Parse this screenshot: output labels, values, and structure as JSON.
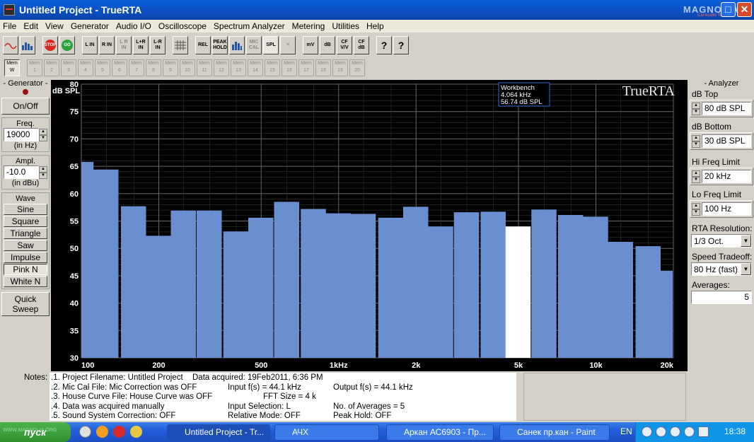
{
  "window": {
    "title": "Untitled Project - TrueRTA",
    "logo_text": "MAGNOLIA",
    "logo_sub": "CarAudio Team"
  },
  "menu": [
    "File",
    "Edit",
    "View",
    "Generator",
    "Audio I/O",
    "Oscilloscope",
    "Spectrum Analyzer",
    "Metering",
    "Utilities",
    "Help"
  ],
  "toolbar": {
    "stop_label": "STOP",
    "go_label": "GO",
    "channel_buttons": [
      "L IN",
      "R IN",
      "L R IN",
      "L+R IN",
      "L-R IN"
    ],
    "view_buttons": [
      "REL",
      "PEAK HOLD",
      "MIC CAL",
      "SPL"
    ],
    "unit_buttons": [
      "mV",
      "dB",
      "CF V/V",
      "CF dB"
    ],
    "help_labels": [
      "?",
      "?"
    ]
  },
  "memory": {
    "active_label": "Mem W",
    "slots": [
      "Mem 1",
      "Mem 2",
      "Mem 3",
      "Mem 4",
      "Mem 5",
      "Mem 6",
      "Mem 7",
      "Mem 8",
      "Mem 9",
      "Mem 10",
      "Mem 11",
      "Mem 12",
      "Mem 13",
      "Mem 14",
      "Mem 15",
      "Mem 16",
      "Mem 17",
      "Mem 18",
      "Mem 19",
      "Mem 20"
    ]
  },
  "generator": {
    "title": "Generator",
    "onoff_label": "On/Off",
    "freq_label": "Freq.",
    "freq_value": "19000",
    "freq_unit": "(in Hz)",
    "ampl_label": "Ampl.",
    "ampl_value": "-10.0",
    "ampl_unit": "(in dBu)",
    "wave_label": "Wave",
    "waves": [
      "Sine",
      "Square",
      "Triangle",
      "Saw",
      "Impulse",
      "Pink N",
      "White N"
    ],
    "quick_sweep_label": [
      "Quick",
      "Sweep"
    ]
  },
  "analyzer": {
    "title": "Analyzer",
    "db_top_label": "dB Top",
    "db_top_value": "80 dB SPL",
    "db_bottom_label": "dB Bottom",
    "db_bottom_value": "30 dB SPL",
    "hi_freq_label": "Hi Freq Limit",
    "hi_freq_value": "20 kHz",
    "lo_freq_label": "Lo Freq Limit",
    "lo_freq_value": "100 Hz",
    "resolution_label": "RTA Resolution:",
    "resolution_value": "1/3 Oct.",
    "speed_label": "Speed Tradeoff:",
    "speed_value": "80 Hz (fast)",
    "averages_label": "Averages:",
    "averages_value": "5"
  },
  "chart_data": {
    "type": "bar",
    "ylabel": "dB SPL",
    "ylim": [
      30,
      80
    ],
    "yticks": [
      30,
      35,
      40,
      45,
      50,
      55,
      60,
      65,
      70,
      75,
      80
    ],
    "xscale": "log",
    "xlim": [
      100,
      20000
    ],
    "xtick_labels": [
      {
        "x": 100,
        "label": "100"
      },
      {
        "x": 200,
        "label": "200"
      },
      {
        "x": 500,
        "label": "500"
      },
      {
        "x": 1000,
        "label": "1kHz"
      },
      {
        "x": 2000,
        "label": "2k"
      },
      {
        "x": 5000,
        "label": "5k"
      },
      {
        "x": 10000,
        "label": "10k"
      },
      {
        "x": 20000,
        "label": "20k"
      }
    ],
    "brand": "TrueRTA",
    "cursor": {
      "title": "Workbench",
      "freq": "4.064 kHz",
      "level": "56.74 dB SPL"
    },
    "highlight_band": 17,
    "bands": [
      100,
      125,
      160,
      200,
      250,
      315,
      400,
      500,
      630,
      800,
      1000,
      1250,
      1600,
      2000,
      2500,
      3150,
      4000,
      5000,
      6300,
      8000,
      10000,
      12500,
      16000,
      20000
    ],
    "values": [
      65.8,
      64.4,
      57.7,
      52.3,
      56.9,
      56.9,
      53.1,
      55.6,
      58.5,
      57.2,
      56.4,
      56.3,
      55.6,
      57.6,
      54.0,
      56.6,
      56.7,
      54.0,
      57.1,
      56.1,
      55.8,
      51.2,
      50.4,
      45.9
    ],
    "bar_color": "#6a8fd0",
    "highlight_color": "#ffffff",
    "grid": true
  },
  "notes": {
    "label": "Notes:",
    "lines": [
      ".1. Project Filename: Untitled Project",
      ".2. Mic Cal File: Mic Correction was OFF",
      ".3. House Curve File: House Curve was OFF",
      ".4. Data was acquired manually",
      ".5. Sound System Correction: OFF"
    ],
    "acquired": "Data acquired: 19Feb2011, 6:36 PM",
    "input_fs": "Input f(s) = 44.1 kHz",
    "fft_size": "FFT Size = 4 k",
    "input_selection": "Input Selection: L",
    "relative_mode": "Relative Mode: OFF",
    "output_fs": "Output f(s) = 44.1 kHz",
    "averages": "No. of Averages = 5",
    "peak_hold": "Peak Hold: OFF"
  },
  "taskbar": {
    "start_label": "пуск",
    "watermark": "WWW.MAGNOLIA.ORG",
    "tasks": [
      "Untitled Project - Tr...",
      "АЧХ",
      "Аркан АС6903 - Пр...",
      "Санек пр.кан - Paint"
    ],
    "lang": "EN",
    "clock": "18:38"
  }
}
